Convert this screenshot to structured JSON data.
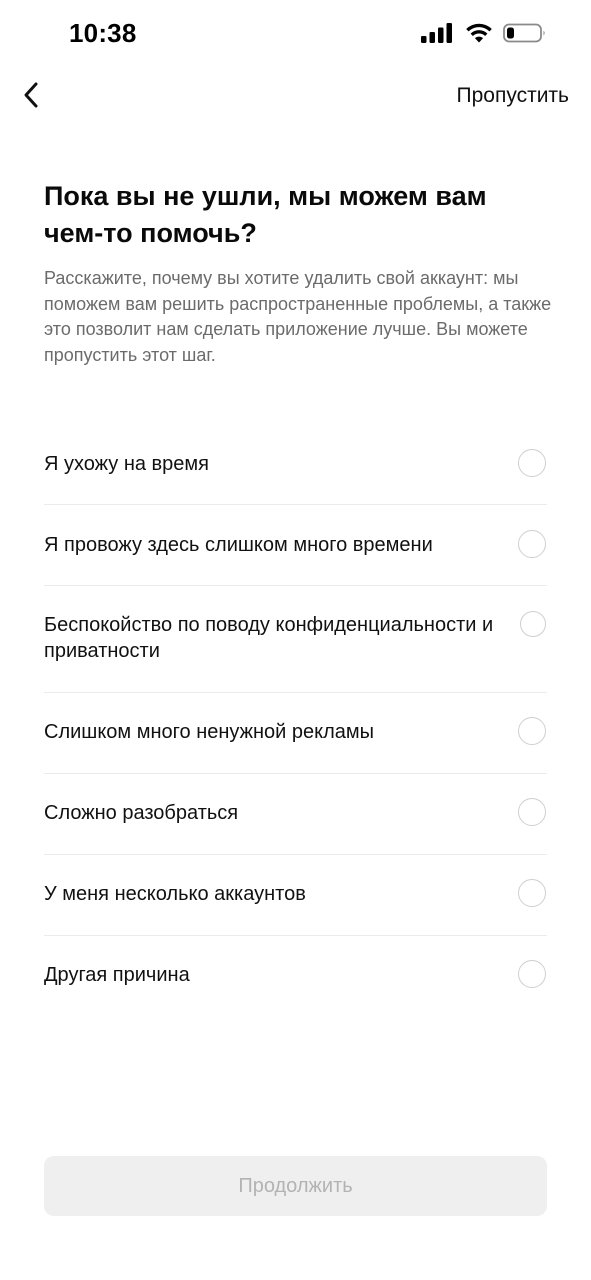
{
  "status_bar": {
    "time": "10:38",
    "icons": [
      "cellular-signal-icon",
      "wifi-icon",
      "battery-icon"
    ],
    "battery_level": 0.15
  },
  "nav": {
    "back_icon": "chevron-left-icon",
    "skip_label": "Пропустить"
  },
  "header": {
    "title": "Пока вы не ушли, мы можем вам чем-то помочь?",
    "description": "Расскажите, почему вы хотите удалить свой аккаунт: мы поможем вам решить распространенные проблемы, а также это позволит нам сделать приложение лучше. Вы можете пропустить этот шаг."
  },
  "options": [
    {
      "label": "Я ухожу на время",
      "selected": false
    },
    {
      "label": "Я провожу здесь слишком много времени",
      "selected": false
    },
    {
      "label": "Беспокойство по поводу конфиденциальности и приватности",
      "selected": false
    },
    {
      "label": "Слишком много ненужной рекламы",
      "selected": false
    },
    {
      "label": "Сложно разобраться",
      "selected": false
    },
    {
      "label": "У меня несколько аккаунтов",
      "selected": false
    },
    {
      "label": "Другая причина",
      "selected": false
    }
  ],
  "footer": {
    "continue_label": "Продолжить",
    "continue_enabled": false
  },
  "colors": {
    "text_primary": "#111111",
    "text_secondary": "#6b6b6b",
    "divider": "#ebebeb",
    "radio_border": "#cfcfcf",
    "button_disabled_bg": "#efefef",
    "button_disabled_text": "#b3b3b3"
  }
}
